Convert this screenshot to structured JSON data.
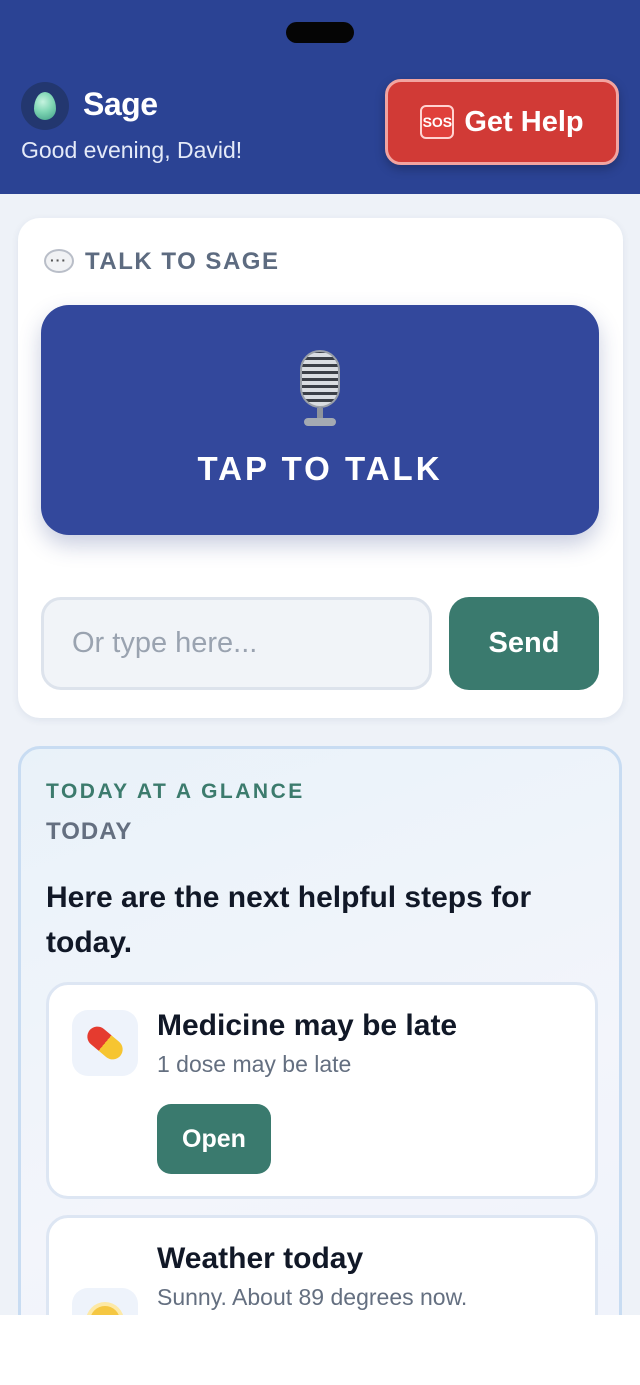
{
  "header": {
    "app_name": "Sage",
    "greeting": "Good evening, David!",
    "help_icon_text": "SOS",
    "help_label": "Get Help"
  },
  "talk": {
    "section_title": "TALK TO SAGE",
    "talk_button_label": "TAP TO TALK",
    "input_placeholder": "Or type here...",
    "input_value": "",
    "send_label": "Send"
  },
  "glance": {
    "eyebrow": "TODAY AT A GLANCE",
    "subtitle": "TODAY",
    "lead": "Here are the next helpful steps for today.",
    "items": [
      {
        "icon": "pill-icon",
        "title": "Medicine may be late",
        "description": "1 dose may be late",
        "action_label": "Open"
      },
      {
        "icon": "sun-icon",
        "title": "Weather today",
        "description": "Sunny. About 89 degrees now."
      }
    ]
  },
  "colors": {
    "header_bg": "#2b4394",
    "help_button": "#d13a36",
    "talk_button": "#33489c",
    "accent_green": "#3a7a6e"
  }
}
